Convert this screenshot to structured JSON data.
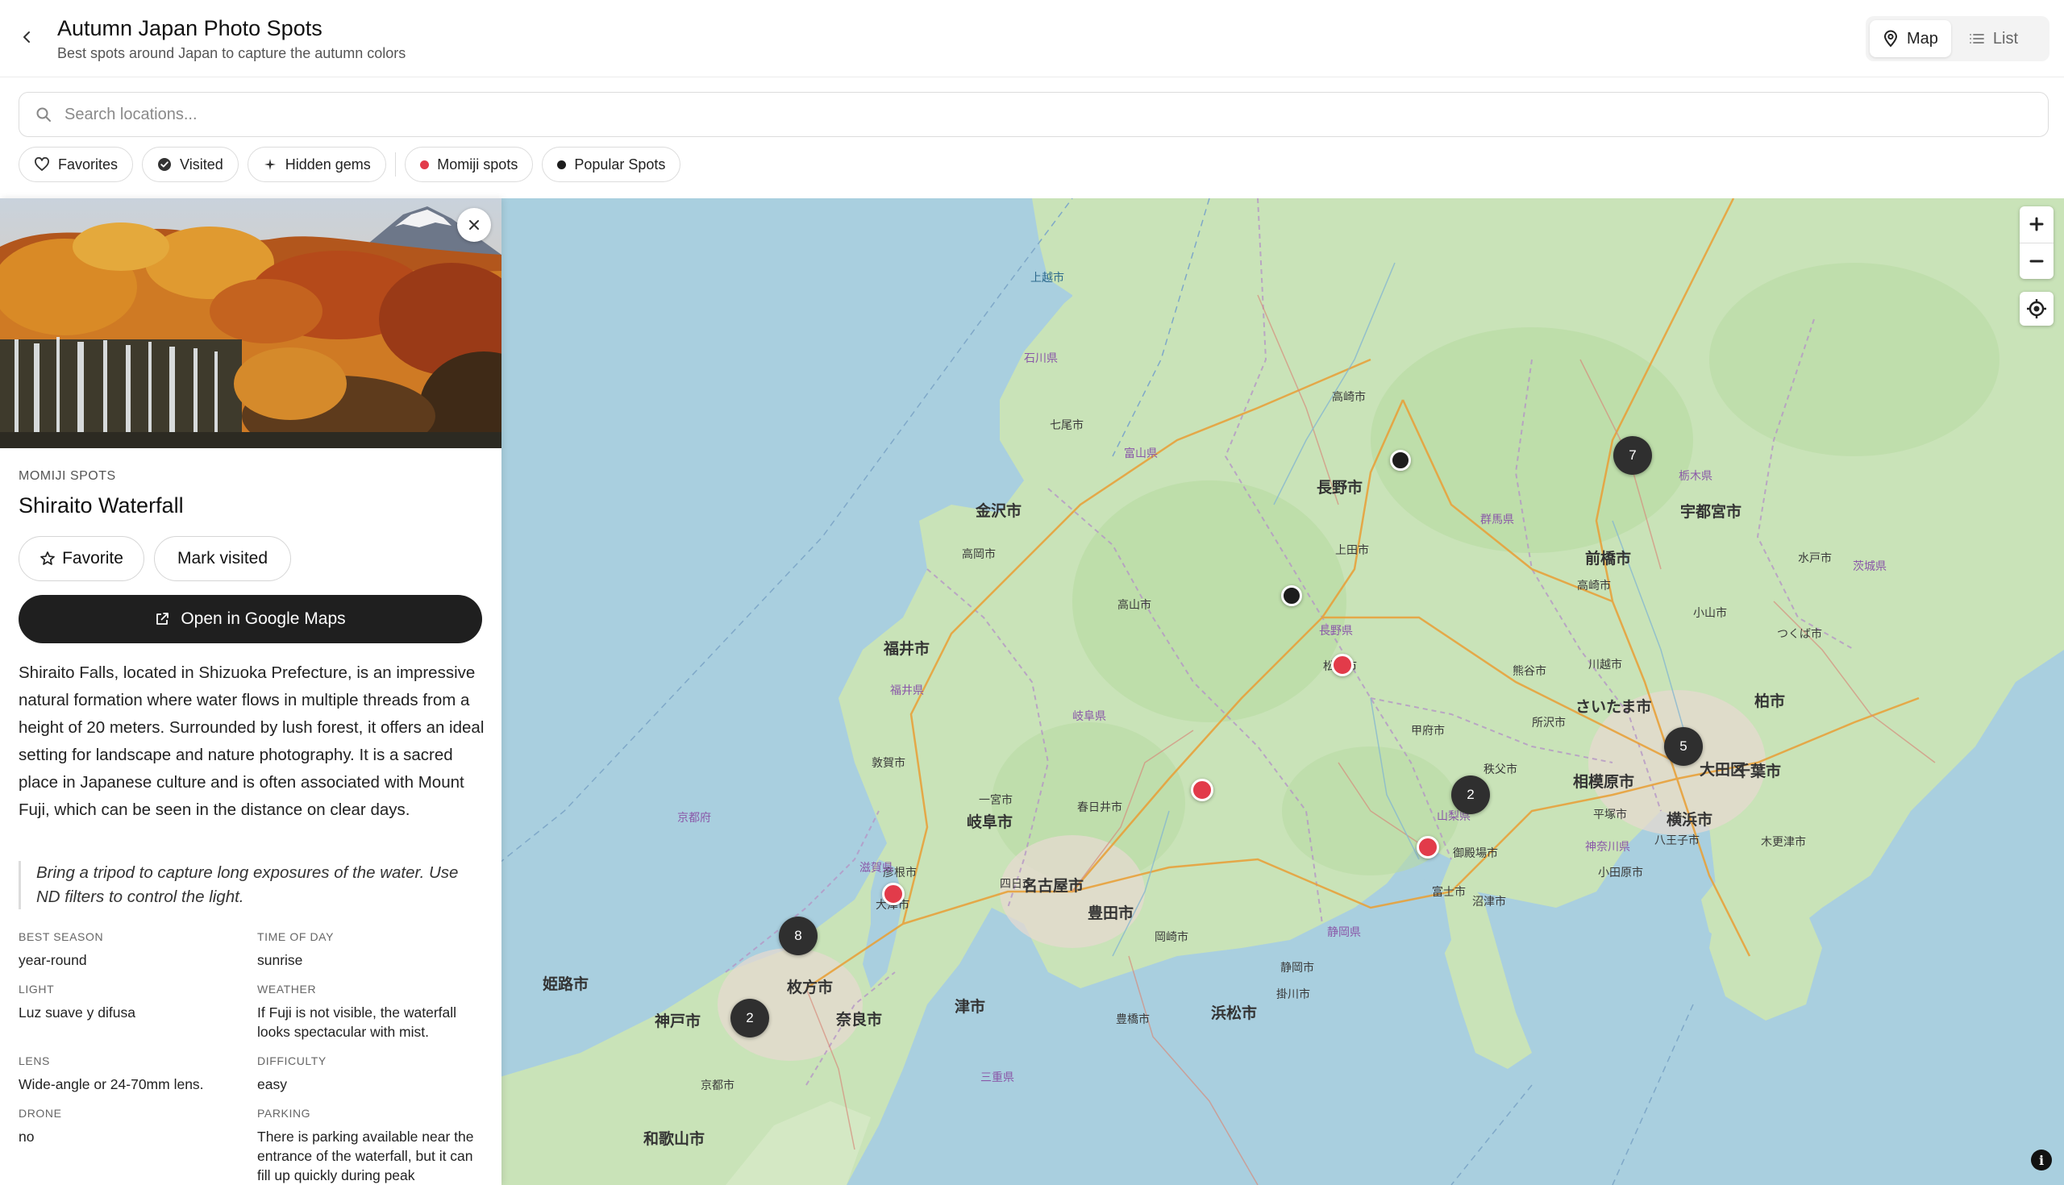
{
  "header": {
    "title": "Autumn Japan Photo Spots",
    "subtitle": "Best spots around Japan to capture the autumn colors",
    "view_map_label": "Map",
    "view_list_label": "List",
    "active_view": "Map"
  },
  "search": {
    "placeholder": "Search locations...",
    "value": ""
  },
  "filters": [
    {
      "label": "Favorites",
      "icon": "heart-icon"
    },
    {
      "label": "Visited",
      "icon": "check-circle-icon"
    },
    {
      "label": "Hidden gems",
      "icon": "sparkle-icon"
    },
    {
      "label": "Momiji spots",
      "icon": "dot",
      "color": "#e23b4a"
    },
    {
      "label": "Popular Spots",
      "icon": "dot",
      "color": "#1d1d1d"
    }
  ],
  "panel": {
    "category": "MOMIJI SPOTS",
    "name": "Shiraito Waterfall",
    "favorite_label": "Favorite",
    "visited_label": "Mark visited",
    "gmaps_label": "Open in Google Maps",
    "description": "Shiraito Falls, located in Shizuoka Prefecture, is an impressive natural formation where water flows in multiple threads from a height of 20 meters. Surrounded by lush forest, it offers an ideal setting for landscape and nature photography. It is a sacred place in Japanese culture and is often associated with Mount Fuji, which can be seen in the distance on clear days.",
    "tip": "Bring a tripod to capture long exposures of the water. Use ND filters to control the light.",
    "fields": {
      "best_season": {
        "label": "BEST SEASON",
        "value": "year-round"
      },
      "time_of_day": {
        "label": "TIME OF DAY",
        "value": "sunrise"
      },
      "light": {
        "label": "LIGHT",
        "value": "Luz suave y difusa"
      },
      "weather": {
        "label": "WEATHER",
        "value": "If Fuji is not visible, the waterfall looks spectacular with mist."
      },
      "lens": {
        "label": "LENS",
        "value": "Wide-angle or 24-70mm lens."
      },
      "difficulty": {
        "label": "DIFFICULTY",
        "value": "easy"
      },
      "drone": {
        "label": "DRONE",
        "value": "no"
      },
      "parking": {
        "label": "PARKING",
        "value": "There is parking available near the entrance of the waterfall, but it can fill up quickly during peak"
      }
    }
  },
  "map": {
    "clusters": [
      "7",
      "5",
      "2",
      "8",
      "2"
    ],
    "colors": {
      "momiji": "#e23b4a",
      "popular": "#1d1d1d",
      "land": "#c9e3b8",
      "water": "#a9cfdf"
    },
    "labels": {
      "kanazawa": "金沢市",
      "nagano": "長野市",
      "maebashi": "前橋市",
      "utsunomiya": "宇都宮市",
      "fukui": "福井市",
      "gifu": "岐阜市",
      "nagoya": "名古屋市",
      "toyota": "豊田市",
      "otsu": "大津市",
      "kyoto": "京都市",
      "nara": "奈良市",
      "kobe": "神戸市",
      "himeji": "姫路市",
      "wakayama": "和歌山市",
      "tsu": "津市",
      "shizuoka": "静岡市",
      "hamamatsu": "浜松市",
      "kofu": "甲府市",
      "saitama": "さいたま市",
      "sagamihara": "相模原市",
      "yokohama": "横浜市",
      "chiba": "千葉市",
      "kashiwa": "柏市",
      "ota": "大田区",
      "hirakata": "枚方市",
      "toyama_pref": "富山県",
      "ishikawa": "石川県",
      "fukui_pref": "福井県",
      "gifu_pref": "岐阜県",
      "nagano_pref": "長野県",
      "gunma": "群馬県",
      "tochigi": "栃木県",
      "shiga": "滋賀県",
      "shizuoka_pref": "静岡県",
      "kanagawa": "神奈川県",
      "ibaraki": "茨城県",
      "yamanashi": "山梨県",
      "mie": "三重県",
      "kyoto_pref": "京都府",
      "joetsu": "上越市",
      "takasaki": "高崎市",
      "ueda": "上田市",
      "matsumoto": "松本市",
      "fuji": "富士市",
      "numazu": "沼津市",
      "takayama": "高山市",
      "takaoka": "高岡市",
      "nanao": "七尾市",
      "tsuruga": "敦賀市",
      "hikone": "彦根市",
      "yokkaichi": "四日市",
      "ichinomiya": "一宮市",
      "kasugai": "春日井市",
      "toyohashi": "豊橋市",
      "okazaki": "岡崎市",
      "kakegawa": "掛川市",
      "gotemba": "御殿場市",
      "odawara": "小田原市",
      "hiratsuka": "平塚市",
      "kisarazu": "木更津市",
      "tsukuba": "つくば市",
      "mito": "水戸市",
      "oyama": "小山市",
      "kumagaya": "熊谷市",
      "chichibu": "秩父市",
      "hachioji": "八王子市",
      "kawagoe": "川越市",
      "tokorozawa": "所沢市"
    }
  }
}
